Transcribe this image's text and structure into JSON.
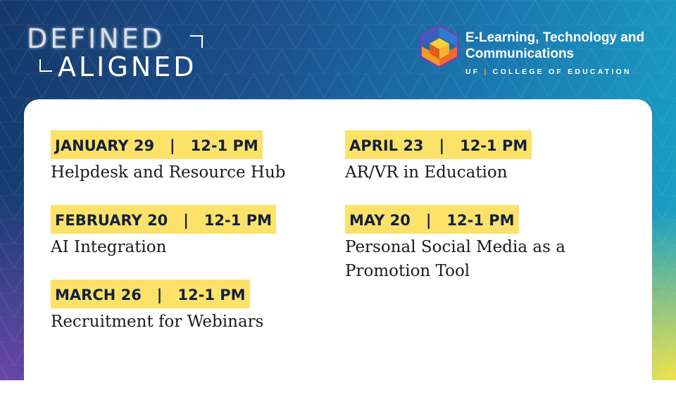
{
  "header": {
    "logo_line1": "DEFINED",
    "logo_line2": "ALIGNED",
    "brand_title": "E-Learning, Technology and Communications",
    "brand_sub_left": "UF",
    "brand_sub_sep": "|",
    "brand_sub_right": "COLLEGE OF EDUCATION"
  },
  "events": [
    {
      "date": "JANUARY 29   |   12-1 PM",
      "title": "Helpdesk and Resource Hub"
    },
    {
      "date": "FEBRUARY 20   |   12-1 PM",
      "title": "AI Integration"
    },
    {
      "date": "MARCH 26   |   12-1 PM",
      "title": "Recruitment for Webinars"
    },
    {
      "date": "APRIL 23   |   12-1 PM",
      "title": "AR/VR in Education"
    },
    {
      "date": "MAY 20   |   12-1 PM",
      "title": "Personal Social Media as a Promotion Tool"
    }
  ],
  "colors": {
    "highlight": "#fde26a",
    "text_dark": "#14213d",
    "accent_orange": "#f5a623"
  },
  "icons": [
    "hexagon-cube-logo-icon"
  ]
}
